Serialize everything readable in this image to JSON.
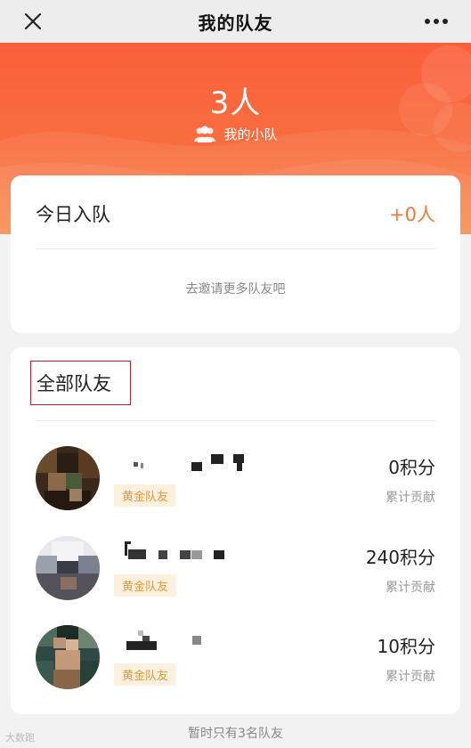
{
  "nav": {
    "title": "我的队友",
    "close_icon": "close-icon",
    "more_icon": "more-dots-icon"
  },
  "hero": {
    "count": "3人",
    "subtitle": "我的小队",
    "icon": "group-icon"
  },
  "today": {
    "label": "今日入队",
    "value": "+0人",
    "invite_text": "去邀请更多队友吧"
  },
  "all_members": {
    "title": "全部队友",
    "members": [
      {
        "badge": "黄金队友",
        "points": "0积分",
        "points_label": "累计贡献"
      },
      {
        "badge": "黄金队友",
        "points": "240积分",
        "points_label": "累计贡献"
      },
      {
        "badge": "黄金队友",
        "points": "10积分",
        "points_label": "累计贡献"
      }
    ]
  },
  "footer": {
    "note": "暂时只有3名队友"
  },
  "watermark": {
    "text": "大数跑"
  },
  "colors": {
    "accent": "#fb5f3b",
    "value_orange": "#f27a3a",
    "badge_bg": "#fdf0dd",
    "badge_text": "#e39a3c",
    "highlight_border": "#b8202a"
  }
}
